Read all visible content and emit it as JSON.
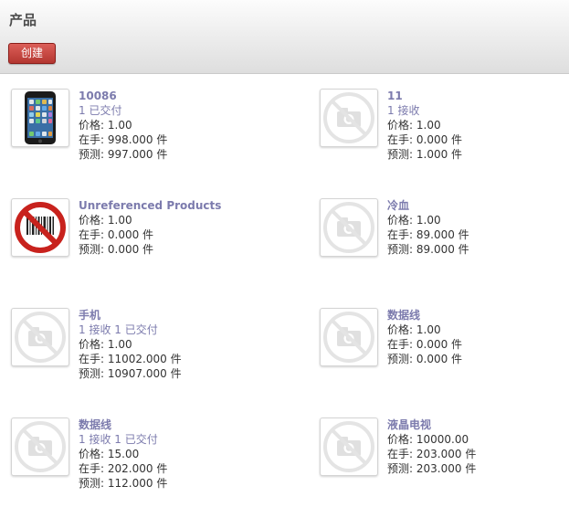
{
  "header": {
    "title": "产品",
    "create_label": "创建"
  },
  "labels": {
    "price": "价格:",
    "onhand": "在手:",
    "forecast": "预测:"
  },
  "products": [
    {
      "name": "10086",
      "moves": [
        "1 已交付"
      ],
      "price": "1.00",
      "onhand": "998.000 件",
      "forecast": "997.000 件",
      "image": "phone"
    },
    {
      "name": "11",
      "moves": [
        "1 接收"
      ],
      "price": "1.00",
      "onhand": "0.000 件",
      "forecast": "1.000 件",
      "image": "placeholder"
    },
    {
      "name": "Unreferenced Products",
      "moves": [],
      "price": "1.00",
      "onhand": "0.000 件",
      "forecast": "0.000 件",
      "image": "no-barcode"
    },
    {
      "name": "冷血",
      "moves": [],
      "price": "1.00",
      "onhand": "89.000 件",
      "forecast": "89.000 件",
      "image": "placeholder"
    },
    {
      "name": "手机",
      "moves": [
        "1 接收",
        "1 已交付"
      ],
      "price": "1.00",
      "onhand": "11002.000 件",
      "forecast": "10907.000 件",
      "image": "placeholder"
    },
    {
      "name": "数据线",
      "moves": [],
      "price": "1.00",
      "onhand": "0.000 件",
      "forecast": "0.000 件",
      "image": "placeholder"
    },
    {
      "name": "数据线",
      "moves": [
        "1 接收",
        "1 已交付"
      ],
      "price": "15.00",
      "onhand": "202.000 件",
      "forecast": "112.000 件",
      "image": "placeholder"
    },
    {
      "name": "液晶电视",
      "moves": [],
      "price": "10000.00",
      "onhand": "203.000 件",
      "forecast": "203.000 件",
      "image": "placeholder"
    }
  ],
  "colors": {
    "accent": "#7c7bad",
    "button": "#c0403a"
  }
}
